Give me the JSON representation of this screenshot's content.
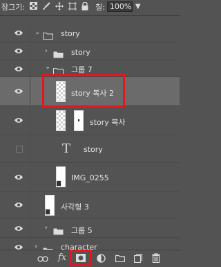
{
  "toolbar": {
    "lock_label": "잠그기:",
    "fill_label": "칠:",
    "fill_value": "100%",
    "icons": [
      "lock-transparent-icon",
      "lock-brush-icon",
      "lock-move-icon",
      "lock-artboard-icon",
      "lock-all-icon"
    ]
  },
  "layers": [
    {
      "name": "story",
      "type": "group",
      "expanded": true,
      "visible": true
    },
    {
      "name": "story",
      "type": "group",
      "expanded": false,
      "visible": true
    },
    {
      "name": "그룹 7",
      "type": "group",
      "expanded": true,
      "visible": true
    },
    {
      "name": "story 복사 2",
      "type": "layer",
      "visible": true,
      "selected": true
    },
    {
      "name": "story 복사",
      "type": "layer",
      "visible": true
    },
    {
      "name": "story",
      "type": "text",
      "visible": false
    },
    {
      "name": "IMG_0255",
      "type": "smart-object",
      "visible": true
    },
    {
      "name": "사각형 3",
      "type": "shape",
      "visible": true
    },
    {
      "name": "그룹 5",
      "type": "group",
      "expanded": false,
      "visible": true
    },
    {
      "name": "character",
      "type": "group",
      "expanded": false,
      "visible": true
    }
  ],
  "bottom_bar": {
    "icons": [
      "link-icon",
      "fx-icon",
      "add-mask-icon",
      "adjustment-icon",
      "new-group-icon",
      "new-layer-icon",
      "trash-icon"
    ],
    "fx_label": "fx"
  },
  "colors": {
    "highlight": "#e3171c",
    "panel": "#535353",
    "selected_row": "#6b6b6b"
  }
}
